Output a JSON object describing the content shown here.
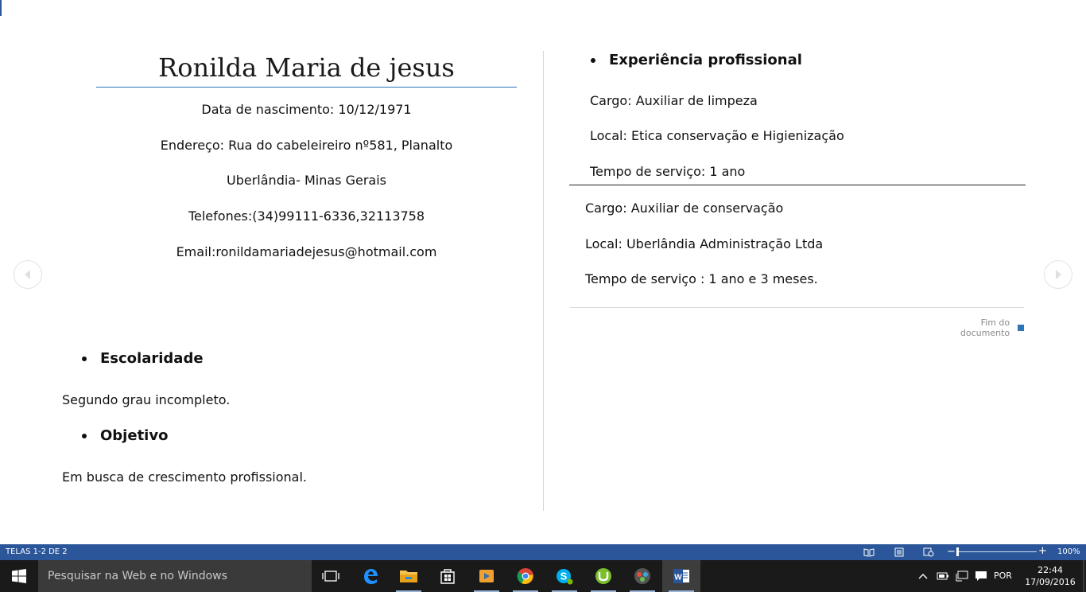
{
  "document": {
    "name": "Ronilda Maria de jesus",
    "info_lines": [
      "Data de nascimento: 10/12/1971",
      "Endereço: Rua do cabeleireiro nº581, Planalto",
      "Uberlândia- Minas Gerais",
      "Telefones:(34)99111-6336,32113758",
      "Email:ronildamariadejesus@hotmail.com"
    ],
    "education_heading": "Escolaridade",
    "education_text": "Segundo grau incompleto.",
    "objective_heading": "Objetivo",
    "objective_text": "Em busca de crescimento profissional.",
    "experience_heading": "Experiência profissional",
    "job1": {
      "role": "Cargo: Auxiliar de limpeza",
      "place": "Local: Etica conservação e Higienização",
      "duration": "Tempo de serviço: 1 ano"
    },
    "job2": {
      "role": "Cargo: Auxiliar de conservação",
      "place": "Local: Uberlândia Administração Ltda",
      "duration": "Tempo de serviço : 1 ano e 3 meses."
    },
    "end_label": "Fim do documento"
  },
  "statusbar": {
    "pages": "TELAS 1-2 DE 2",
    "zoom_label": "100%",
    "zoom_minus": "−",
    "zoom_plus": "+"
  },
  "taskbar": {
    "search_placeholder": "Pesquisar na Web e no Windows",
    "language": "POR",
    "time": "22:44",
    "date": "17/09/2016",
    "apps": [
      "task-view",
      "edge",
      "file-explorer",
      "store",
      "media-player",
      "chrome",
      "skype",
      "utorrent",
      "game-app",
      "word"
    ]
  },
  "colors": {
    "accent": "#2b579a",
    "name_rule": "#2e75b6",
    "taskbar": "#1a1a1a"
  }
}
